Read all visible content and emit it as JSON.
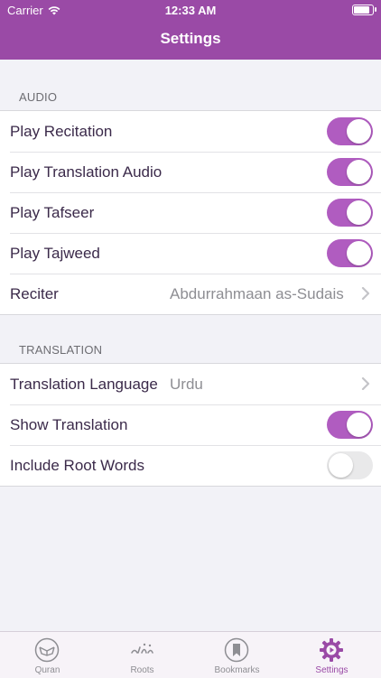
{
  "status_bar": {
    "carrier": "Carrier",
    "time": "12:33 AM"
  },
  "nav": {
    "title": "Settings"
  },
  "audio": {
    "header": "AUDIO",
    "play_recitation": {
      "label": "Play Recitation",
      "on": true
    },
    "play_translation_audio": {
      "label": "Play Translation Audio",
      "on": true
    },
    "play_tafseer": {
      "label": "Play Tafseer",
      "on": true
    },
    "play_tajweed": {
      "label": "Play Tajweed",
      "on": true
    },
    "reciter": {
      "label": "Reciter",
      "value": "Abdurrahmaan as-Sudais"
    }
  },
  "translation": {
    "header": "TRANSLATION",
    "language": {
      "label": "Translation Language",
      "value": "Urdu"
    },
    "show_translation": {
      "label": "Show Translation",
      "on": true
    },
    "include_root_words": {
      "label": "Include Root Words",
      "on": false
    }
  },
  "tabs": [
    {
      "label": "Quran",
      "icon": "quran-icon",
      "active": false
    },
    {
      "label": "Roots",
      "icon": "roots-icon",
      "active": false
    },
    {
      "label": "Bookmarks",
      "icon": "bookmark-icon",
      "active": false
    },
    {
      "label": "Settings",
      "icon": "gear-icon",
      "active": true
    }
  ],
  "colors": {
    "accent": "#9a4aa6",
    "toggle_on": "#b05cc0",
    "toggle_off": "#e9e9ea"
  }
}
